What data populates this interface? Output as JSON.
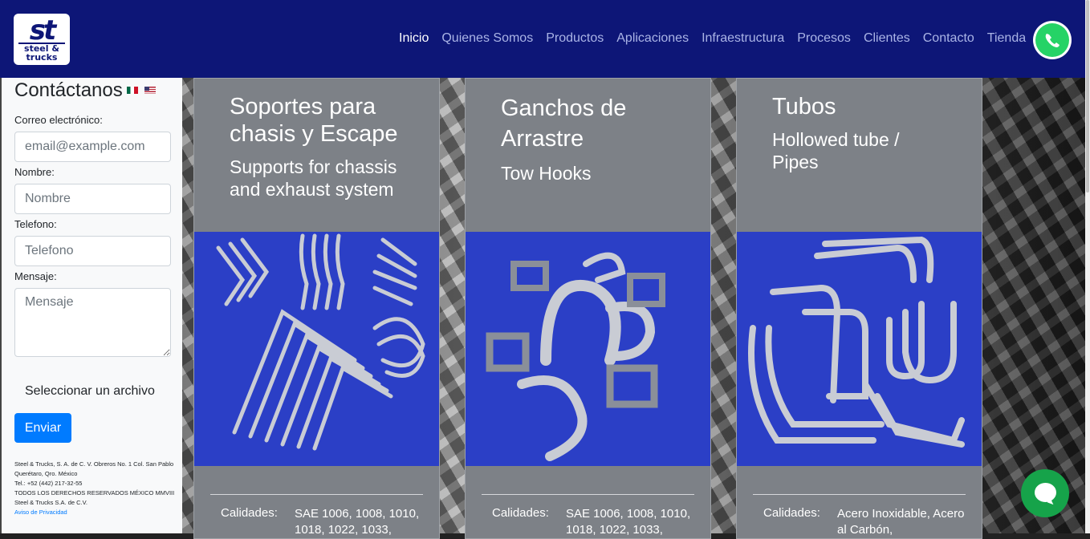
{
  "brand": {
    "logo_main": "st",
    "logo_sub": "steel & trucks"
  },
  "nav": {
    "items": [
      {
        "label": "Inicio",
        "active": true
      },
      {
        "label": "Quienes Somos"
      },
      {
        "label": "Productos"
      },
      {
        "label": "Aplicaciones"
      },
      {
        "label": "Infraestructura"
      },
      {
        "label": "Procesos"
      },
      {
        "label": "Clientes"
      },
      {
        "label": "Contacto"
      },
      {
        "label": "Tienda"
      }
    ]
  },
  "contact": {
    "title": "Contáctanos",
    "email_label": "Correo electrónico:",
    "email_placeholder": "email@example.com",
    "name_label": "Nombre:",
    "name_placeholder": "Nombre",
    "phone_label": "Telefono:",
    "phone_placeholder": "Telefono",
    "message_label": "Mensaje:",
    "message_placeholder": "Mensaje",
    "file_label": "Seleccionar un archivo",
    "submit_label": "Enviar"
  },
  "footer": {
    "address": "Steel & Trucks, S. A. de C. V. Obreros No. 1 Col. San Pablo Querétaro, Qro. México",
    "phone": "Tel.: +52 (442) 217-32-55",
    "rights": "TODOS LOS DERECHOS RESERVADOS MÉXICO MMVIII Steel & Trucks S.A. de C.V.",
    "privacy": "Aviso de Privacidad"
  },
  "cards": [
    {
      "title": "Soportes para chasis y Escape",
      "subtitle": "Supports for chassis and exhaust system",
      "quality_label": "Calidades:",
      "quality_value": "SAE 1006, 1008, 1010, 1018, 1022, 1033,"
    },
    {
      "title": "Ganchos de Arrastre",
      "subtitle": "Tow Hooks",
      "quality_label": "Calidades:",
      "quality_value": "SAE 1006, 1008, 1010, 1018, 1022, 1033,"
    },
    {
      "title": "Tubos",
      "subtitle": "Hollowed tube / Pipes",
      "quality_label": "Calidades:",
      "quality_value": "Acero Inoxidable, Acero al Carbón,"
    }
  ],
  "colors": {
    "header": "#0d1677",
    "card": "#7d8187",
    "image_bg": "#2b3fc6",
    "button": "#007bff",
    "chat": "#16a34a",
    "whatsapp": "#25d366"
  }
}
